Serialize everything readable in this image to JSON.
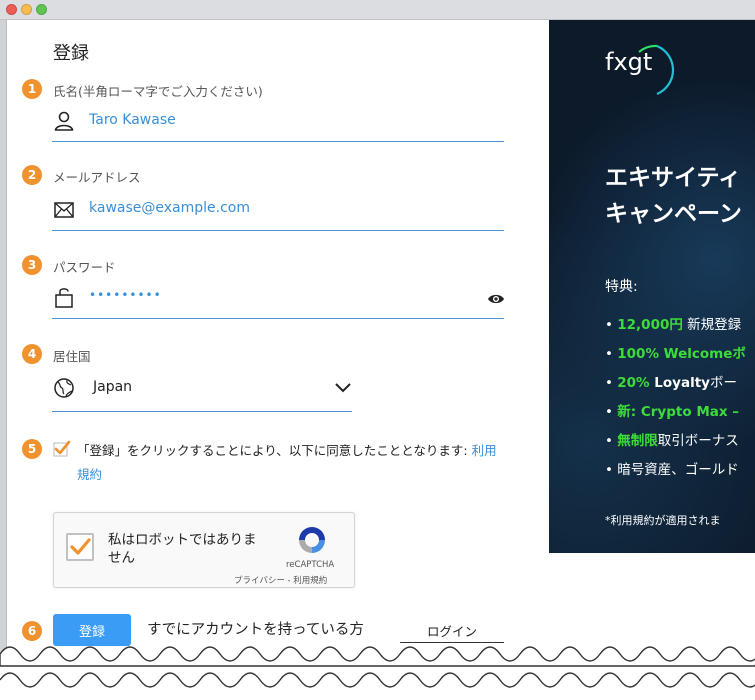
{
  "form": {
    "title": "登録",
    "steps": [
      "1",
      "2",
      "3",
      "4",
      "5",
      "6"
    ],
    "name": {
      "label": "氏名(半角ローマ字でご入力ください)",
      "value": "Taro Kawase"
    },
    "email": {
      "label": "メールアドレス",
      "value": "kawase@example.com"
    },
    "password": {
      "label": "パスワード",
      "value": "•••••••••"
    },
    "country": {
      "label": "居住国",
      "value": "Japan"
    },
    "agree": {
      "text": "「登録」をクリックすることにより、以下に同意したこととなります: ",
      "link": "利用規約"
    },
    "recaptcha": {
      "label": "私はロボットではありません",
      "brand": "reCAPTCHA",
      "links": "プライバシー - 利用規約"
    },
    "submit_label": "登録",
    "have_account": "すでにアカウントを持っている方",
    "login_label": "ログイン"
  },
  "promo": {
    "logo": "fxgt",
    "headline_1": "エキサイティ",
    "headline_2": "キャンペーン",
    "perks_title": "特典:",
    "perks": [
      {
        "hl": "12,000円",
        "rest": " 新規登録"
      },
      {
        "hl": "100% Welcome",
        "rest": "ボ"
      },
      {
        "hl": "20% ",
        "bold": "Loyalty",
        "rest": "ボー"
      },
      {
        "hl": "新: Crypto Max –"
      },
      {
        "hl": "無制限",
        "rest": "取引ボーナス"
      },
      {
        "rest": "暗号資産、ゴールド"
      }
    ],
    "note": "*利用規約が適用されま"
  },
  "colors": {
    "accent": "#3b9cf5",
    "step": "#f0922d",
    "promo_bg": "#0c1a2a",
    "highlight": "#3ddc3a"
  }
}
